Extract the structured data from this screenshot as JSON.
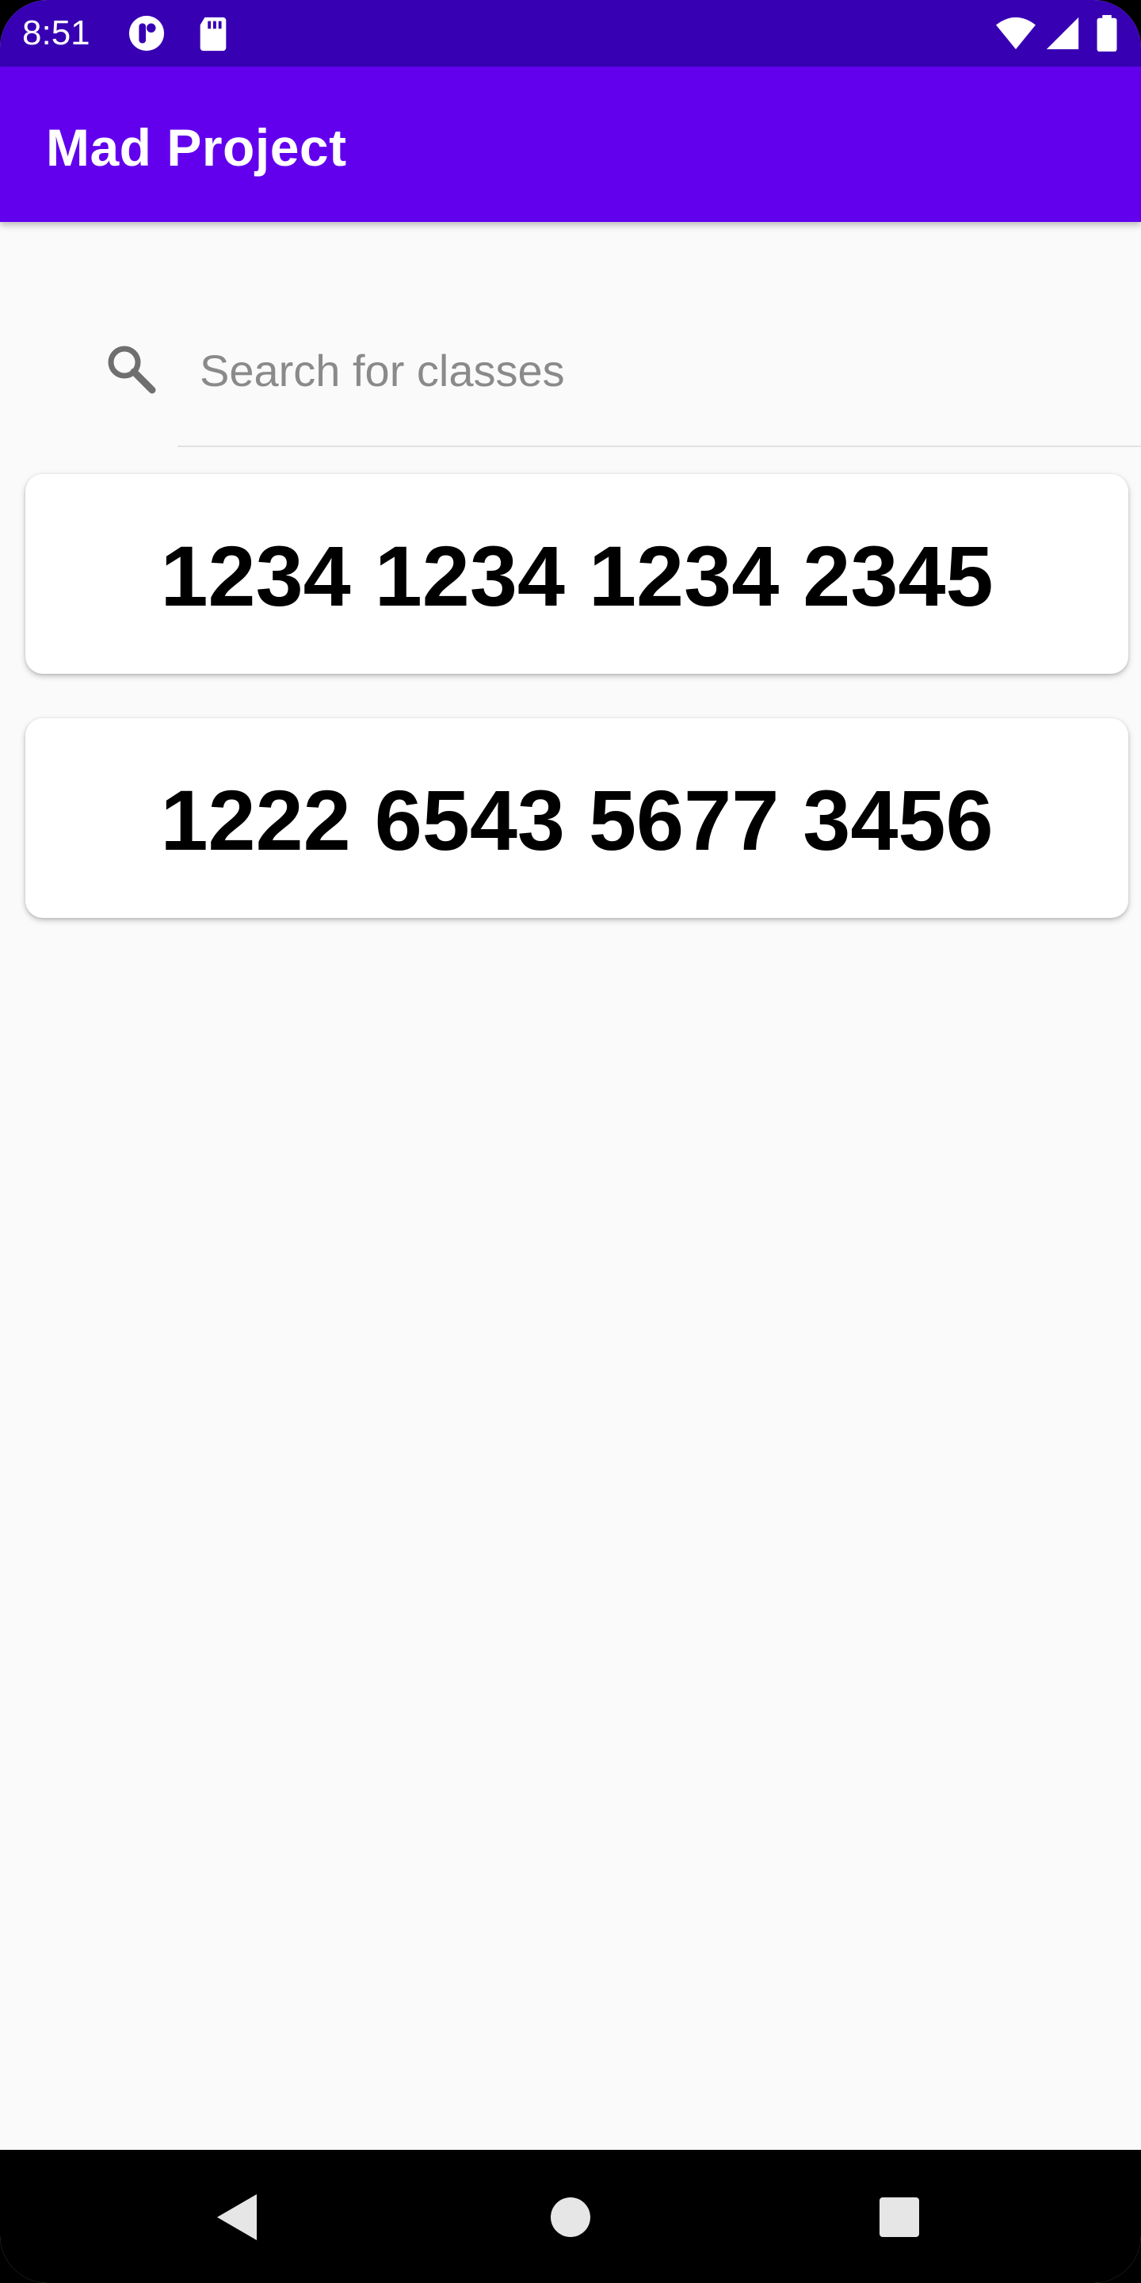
{
  "status_bar": {
    "time": "8:51",
    "icons": [
      "notification-app-icon",
      "sd-card-icon",
      "wifi-icon",
      "cell-signal-icon",
      "battery-icon"
    ]
  },
  "app_bar": {
    "title": "Mad Project"
  },
  "search": {
    "placeholder": "Search for classes",
    "value": "",
    "icon": "search-icon"
  },
  "cards": [
    {
      "text": "1234 1234 1234 2345"
    },
    {
      "text": "1222 6543 5677 3456"
    }
  ],
  "nav_bar": {
    "buttons": [
      "back-icon",
      "home-icon",
      "recents-icon"
    ]
  },
  "colors": {
    "status_bar": "#3700b3",
    "app_bar": "#6200ee",
    "background": "#fafafa",
    "card": "#ffffff",
    "nav_bar": "#000000"
  }
}
